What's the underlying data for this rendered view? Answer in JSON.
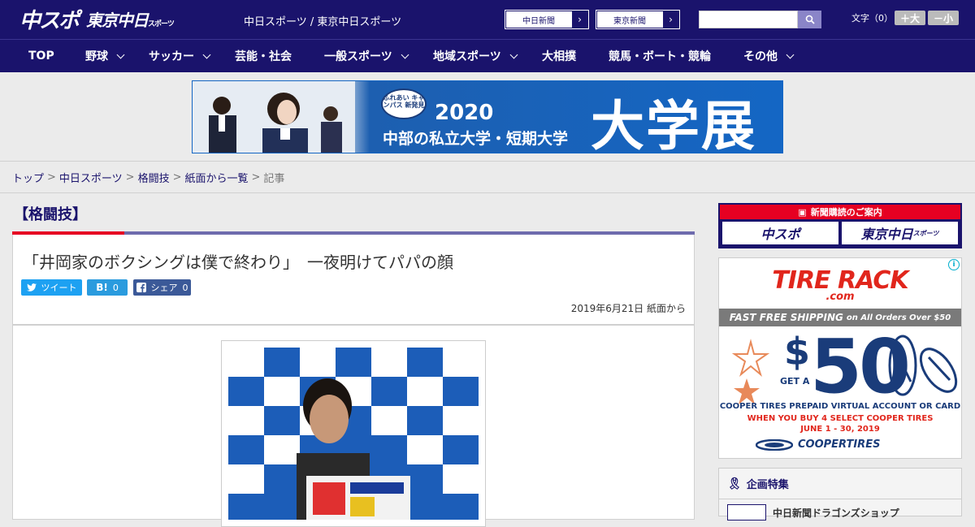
{
  "header": {
    "logo_chuspo": "中スポ",
    "logo_tokyo": "東京中日",
    "logo_tokyo_sub": "スポーツ",
    "site_title": "中日スポーツ / 東京中日スポーツ",
    "paper_links": [
      "中日新聞",
      "東京新聞"
    ],
    "search_placeholder": "",
    "font_size_label": "文字（0）",
    "font_increase": "＋大",
    "font_decrease": "－小"
  },
  "nav": {
    "items": [
      {
        "label": "TOP",
        "dropdown": false
      },
      {
        "label": "野球",
        "dropdown": true
      },
      {
        "label": "サッカー",
        "dropdown": true
      },
      {
        "label": "芸能・社会",
        "dropdown": false
      },
      {
        "label": "一般スポーツ",
        "dropdown": true
      },
      {
        "label": "地域スポーツ",
        "dropdown": true
      },
      {
        "label": "大相撲",
        "dropdown": false
      },
      {
        "label": "競馬・ボート・競輪",
        "dropdown": false
      },
      {
        "label": "その他",
        "dropdown": true
      }
    ]
  },
  "banner": {
    "badge": "ふれあい キャンパス 新発見",
    "year": "2020",
    "subtitle": "中部の私立大学・短期大学",
    "big": "大学展"
  },
  "breadcrumb": {
    "items": [
      "トップ",
      "中日スポーツ",
      "格闘技",
      "紙面から一覧"
    ],
    "current": "記事"
  },
  "article": {
    "category": "【格闘技】",
    "title": "「井岡家のボクシングは僕で終わり」　一夜明けてパパの顔",
    "share": {
      "tweet": "ツイート",
      "hatena_label": "B!",
      "hatena_count": "0",
      "facebook": "シェア",
      "facebook_count": "0"
    },
    "date": "2019年6月21日 紙面から"
  },
  "sidebar": {
    "subscribe_head": "新聞購読のご案内",
    "subscribe_logos": [
      "中スポ",
      "東京中日"
    ],
    "subscribe_logo_sub": "スポーツ",
    "ad": {
      "brand": "TIRE RACK",
      "brand_sub": ".com",
      "strip": "FAST FREE SHIPPING",
      "strip_small": "on All Orders Over $50",
      "get_a": "GET A",
      "dollar": "$",
      "amount": "50",
      "line1": "COOPER TIRES PREPAID VIRTUAL ACCOUNT OR CARD",
      "line2": "WHEN YOU BUY 4 SELECT COOPER TIRES",
      "line3": "JUNE 1 - 30, 2019",
      "cooper": "COOPERTIRES",
      "info": "i"
    },
    "feature_title": "企画特集",
    "feature_item": "中日新聞ドラゴンズショップ"
  },
  "colors": {
    "navy": "#1a136c",
    "red": "#e60022",
    "purple": "#6e6bad"
  }
}
